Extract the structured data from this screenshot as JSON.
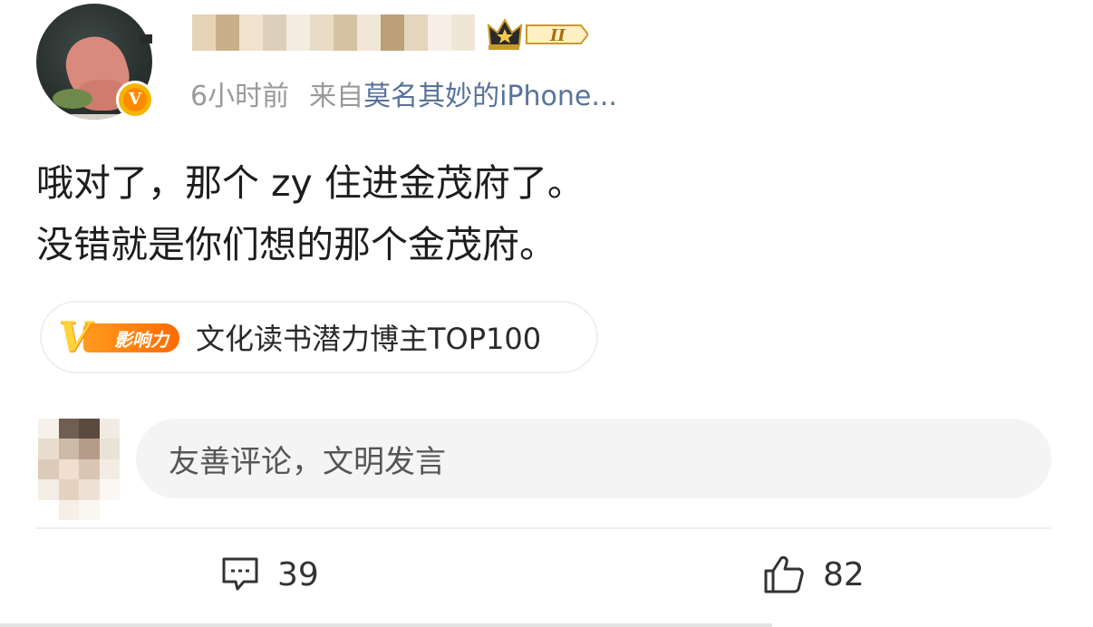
{
  "post": {
    "meta": {
      "time": "6小时前",
      "source_prefix": "来自",
      "source_name": "莫名其妙的iPhone..."
    },
    "vip_level": "II",
    "verified_mark": "V",
    "text_lines": [
      "哦对了，那个 zy 住进金茂府了。",
      "没错就是你们想的那个金茂府。"
    ],
    "influence_tag": {
      "badge_letter": "V",
      "badge_label": "影响力",
      "text": "文化读书潜力博主TOP100"
    }
  },
  "comment_box": {
    "placeholder": "友善评论，文明发言"
  },
  "actions": {
    "comments_count": "39",
    "likes_count": "82"
  },
  "colors": {
    "source_link": "#58729a",
    "meta_gray": "#9a9a9a",
    "verified_badge": "#f5b400",
    "influence_orange": "#ff7a00",
    "vip_gold": "#c89a2a"
  }
}
